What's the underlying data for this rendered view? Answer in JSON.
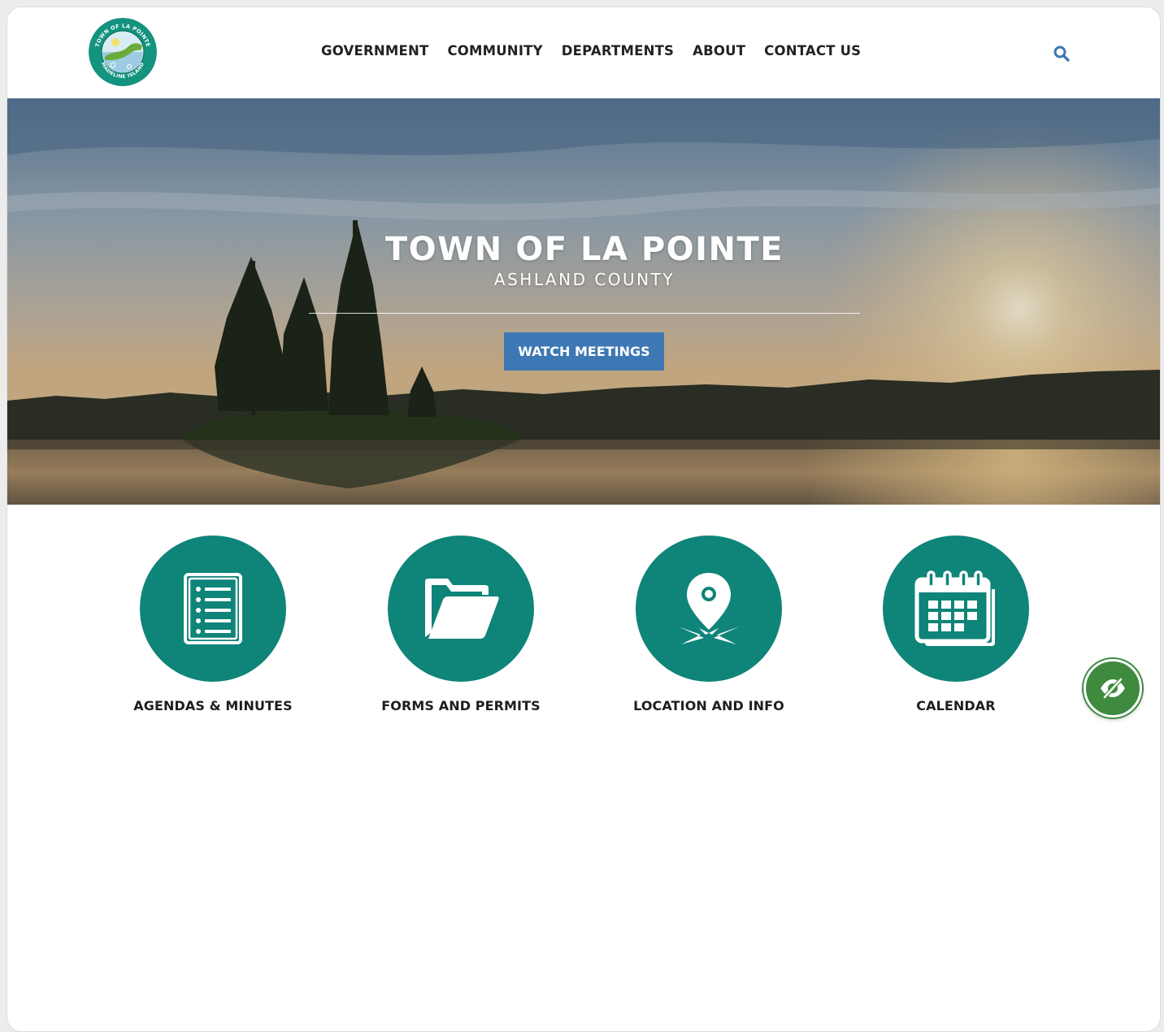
{
  "header": {
    "logo": {
      "ring_top_text": "TOWN OF LA POINTE",
      "ring_bottom_text": "MADELINE ISLAND"
    },
    "nav": [
      {
        "label": "GOVERNMENT"
      },
      {
        "label": "COMMUNITY"
      },
      {
        "label": "DEPARTMENTS"
      },
      {
        "label": "ABOUT"
      },
      {
        "label": "CONTACT US"
      }
    ],
    "search_icon": "search-icon"
  },
  "hero": {
    "title": "TOWN OF LA POINTE",
    "subtitle": "ASHLAND COUNTY",
    "button_label": "WATCH MEETINGS"
  },
  "quicklinks": [
    {
      "label": "AGENDAS & MINUTES",
      "icon": "document-list-icon"
    },
    {
      "label": "FORMS AND PERMITS",
      "icon": "folder-icon"
    },
    {
      "label": "LOCATION AND INFO",
      "icon": "map-pin-icon"
    },
    {
      "label": "CALENDAR",
      "icon": "calendar-icon"
    }
  ],
  "accessibility_button": {
    "icon": "eye-slash-icon"
  },
  "colors": {
    "teal": "#0f8478",
    "button_blue": "#3d78b4",
    "search_blue": "#3d78b4",
    "a11y_green": "#3e8a3e",
    "nav_text": "#222222"
  }
}
